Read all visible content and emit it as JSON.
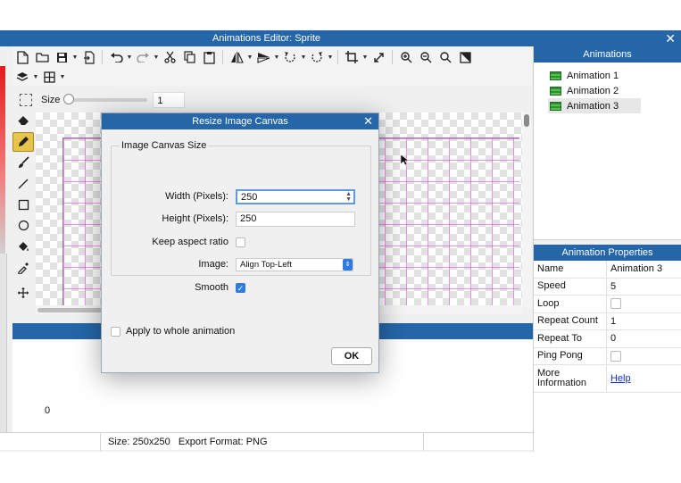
{
  "window": {
    "title": "Animations Editor: Sprite",
    "close_glyph": "✕"
  },
  "toolbar": {
    "row1": [
      "new-file-icon",
      "open-folder-icon",
      "save-icon",
      "export-icon",
      "undo-icon",
      "redo-icon",
      "cut-icon",
      "copy-icon",
      "paste-icon",
      "flip-horizontal-icon",
      "flip-vertical-icon",
      "rotate-left-icon",
      "rotate-right-icon",
      "crop-icon",
      "resize-icon",
      "zoom-in-icon",
      "zoom-out-icon",
      "zoom-reset-icon",
      "fit-icon"
    ],
    "row2": [
      "layers-icon",
      "grid-icon"
    ]
  },
  "size_control": {
    "label": "Size",
    "value": "1"
  },
  "tools": [
    "eraser-icon",
    "pencil-icon",
    "brush-icon",
    "line-icon",
    "rectangle-icon",
    "ellipse-icon",
    "fill-icon",
    "eyedropper-icon",
    "move-icon"
  ],
  "timeline": {
    "frame_label": "0"
  },
  "status": {
    "size": "Size: 250x250",
    "export_format": "Export Format: PNG"
  },
  "animations_panel": {
    "title": "Animations",
    "items": [
      {
        "label": "Animation 1",
        "selected": false
      },
      {
        "label": "Animation 2",
        "selected": false
      },
      {
        "label": "Animation 3",
        "selected": true
      }
    ]
  },
  "properties_panel": {
    "title": "Animation Properties",
    "rows": {
      "name": {
        "label": "Name",
        "value": "Animation 3"
      },
      "speed": {
        "label": "Speed",
        "value": "5"
      },
      "loop": {
        "label": "Loop"
      },
      "repeat_count": {
        "label": "Repeat Count",
        "value": "1"
      },
      "repeat_to": {
        "label": "Repeat To",
        "value": "0"
      },
      "ping_pong": {
        "label": "Ping Pong"
      },
      "more_info": {
        "label_line1": "More",
        "label_line2": "Information",
        "value": "Help"
      }
    }
  },
  "dialog": {
    "title": "Resize Image Canvas",
    "close_glyph": "✕",
    "group_label": "Image Canvas Size",
    "width": {
      "label": "Width (Pixels):",
      "value": "250"
    },
    "height": {
      "label": "Height (Pixels):",
      "value": "250"
    },
    "keep_aspect": {
      "label": "Keep aspect ratio",
      "checked": false
    },
    "image": {
      "label": "Image:",
      "value": "Align Top-Left"
    },
    "smooth": {
      "label": "Smooth",
      "checked": true
    },
    "apply_all": {
      "label": "Apply to whole animation",
      "checked": false
    },
    "ok_label": "OK"
  },
  "colors": {
    "accent": "#2466a8",
    "active_tool": "#e8c54a",
    "grid_line": "#e83ce8",
    "checkbox_checked": "#2f7be0"
  }
}
